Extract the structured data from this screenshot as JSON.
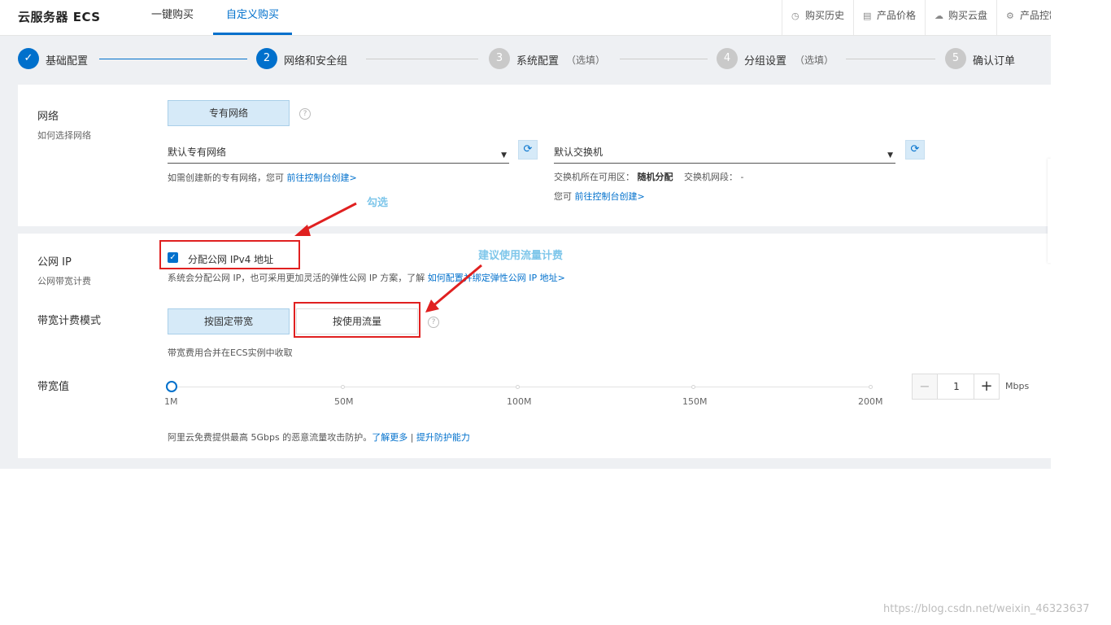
{
  "header": {
    "brand": "云服务器 ECS",
    "tabs": [
      "一键购买",
      "自定义购买"
    ],
    "active_tab_index": 1,
    "right_items": [
      {
        "icon": "clock-icon",
        "label": "购买历史"
      },
      {
        "icon": "document-icon",
        "label": "产品价格"
      },
      {
        "icon": "cloud-icon",
        "label": "购买云盘"
      },
      {
        "icon": "gear-icon",
        "label": "产品控制"
      }
    ]
  },
  "steps": [
    {
      "number": "✓",
      "label": "基础配置",
      "optional": "",
      "status": "done"
    },
    {
      "number": "2",
      "label": "网络和安全组",
      "optional": "",
      "status": "current"
    },
    {
      "number": "3",
      "label": "系统配置",
      "optional": "（选填）",
      "status": "todo"
    },
    {
      "number": "4",
      "label": "分组设置",
      "optional": "（选填）",
      "status": "todo"
    },
    {
      "number": "5",
      "label": "确认订单",
      "optional": "",
      "status": "todo"
    }
  ],
  "network": {
    "label": "网络",
    "help_link": "如何选择网络",
    "type_button": "专有网络",
    "vpc_select": "默认专有网络",
    "vswitch_select": "默认交换机",
    "vpc_note_prefix": "如需创建新的专有网络，您可",
    "vpc_note_link": "前往控制台创建>",
    "zone_label": "交换机所在可用区：",
    "zone_value": "随机分配",
    "cidr_label": "交换机网段：",
    "cidr_value": "-",
    "vswitch_note_prefix": "您可",
    "vswitch_note_link": "前往控制台创建>"
  },
  "public_ip": {
    "label": "公网 IP",
    "sub": "公网带宽计费",
    "checkbox_label": "分配公网 IPv4 地址",
    "checked": true,
    "note_prefix": "系统会分配公网 IP，也可采用更加灵活的弹性公网 IP 方案，了解",
    "note_link": "如何配置并绑定弹性公网 IP 地址>"
  },
  "billing": {
    "label": "带宽计费模式",
    "options": [
      "按固定带宽",
      "按使用流量"
    ],
    "selected_index": 0,
    "note": "带宽费用合并在ECS实例中收取"
  },
  "bandwidth": {
    "label": "带宽值",
    "ticks": [
      "1M",
      "50M",
      "100M",
      "150M",
      "200M"
    ],
    "value": 1,
    "value_text": "1",
    "unit": "Mbps",
    "minus": "−",
    "plus": "+",
    "note_prefix": "阿里云免费提供最高 5Gbps 的恶意流量攻击防护。",
    "note_link1": "了解更多",
    "note_sep": " | ",
    "note_link2": "提升防护能力"
  },
  "annotations": {
    "check": "勾选",
    "suggest": "建议使用流量计费",
    "arrow_color": "#e02020"
  },
  "watermark": "https://blog.csdn.net/weixin_46323637"
}
